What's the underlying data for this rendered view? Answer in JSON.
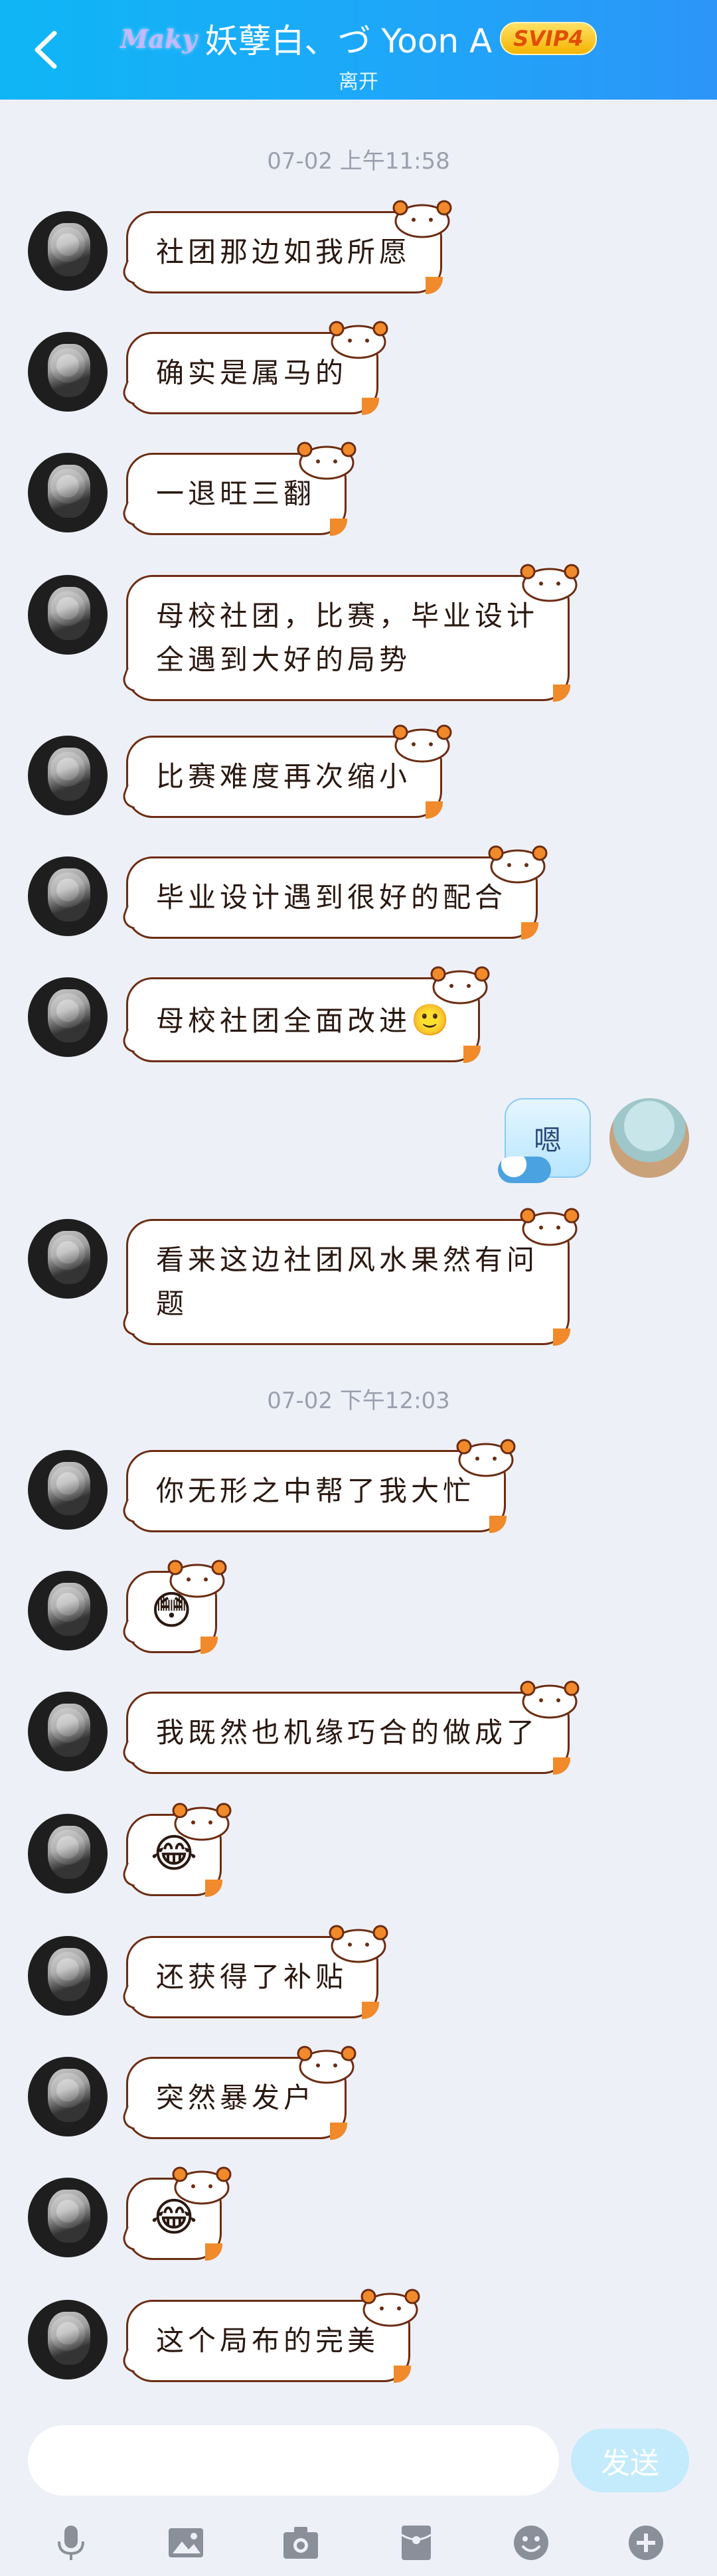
{
  "header": {
    "back_icon": "chevron-left-icon",
    "love_badge": "Maky",
    "title": "妖孽白、づ Yoon A",
    "vip_badge": "SVIP4",
    "status": "离开"
  },
  "timestamps": [
    "07-02 上午11:58",
    "07-02 下午12:03"
  ],
  "messages": [
    {
      "text": "社团那边如我所愿"
    },
    {
      "text": "确实是属马的"
    },
    {
      "text": "一退旺三翻"
    },
    {
      "line1": "母校社团，比赛，毕业设计",
      "line2": "全遇到大好的局势"
    },
    {
      "text": "比赛难度再次缩小"
    },
    {
      "text": "毕业设计遇到很好的配合"
    },
    {
      "text": "母校社团全面改进",
      "emoji": "🙂"
    },
    {
      "text": "嗯",
      "side": "right"
    },
    {
      "line1": "看来这边社团风水果然有问",
      "line2": "题"
    },
    {
      "text": "你无形之中帮了我大忙"
    },
    {
      "emoji": "😳"
    },
    {
      "text": "我既然也机缘巧合的做成了"
    },
    {
      "emoji": "😂"
    },
    {
      "text": "还获得了补贴"
    },
    {
      "text": "突然暴发户"
    },
    {
      "emoji": "😂"
    },
    {
      "text": "这个局布的完美"
    }
  ],
  "input": {
    "placeholder": "",
    "send_label": "发送"
  },
  "toolbar": [
    "microphone-icon",
    "image-icon",
    "camera-icon",
    "red-packet-icon",
    "emoji-icon",
    "plus-icon"
  ],
  "colors": {
    "header_start": "#0fb6f5",
    "header_end": "#2c95f7",
    "bubble_border": "#6b2c12",
    "bubble_accent": "#f08a2a",
    "send_button": "#c3ebfb"
  }
}
